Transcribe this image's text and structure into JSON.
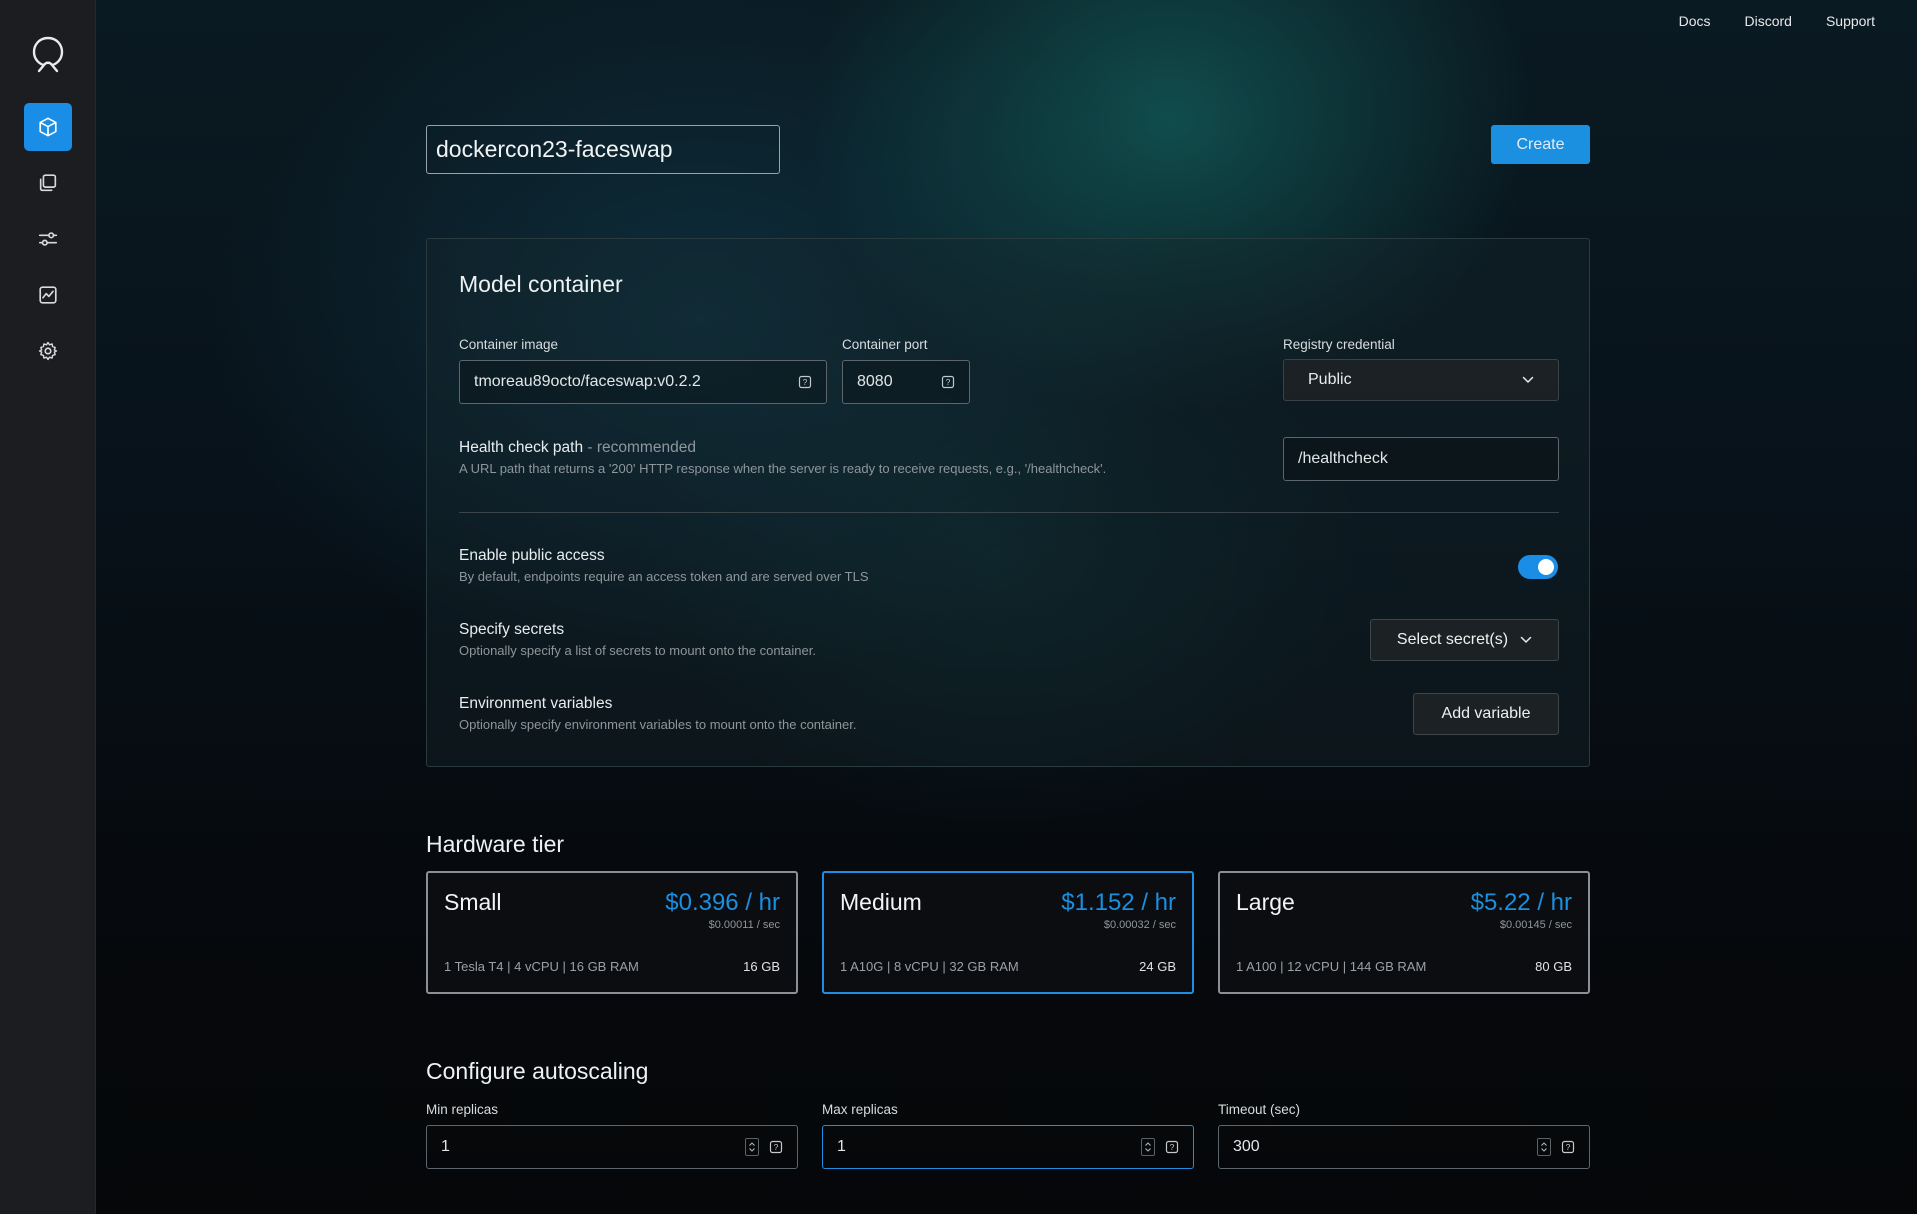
{
  "top_nav": {
    "docs": "Docs",
    "discord": "Discord",
    "support": "Support"
  },
  "sidebar": {
    "icons": [
      "logo-icon",
      "cube-icon",
      "copy-icon",
      "sliders-icon",
      "chart-icon",
      "gear-icon"
    ],
    "active": "cube-icon",
    "accent": "#1a8ee6"
  },
  "header": {
    "name_value": "dockercon23-faceswap",
    "create_label": "Create"
  },
  "model_container": {
    "title": "Model container",
    "container_image_label": "Container image",
    "container_image_value": "tmoreau89octo/faceswap:v0.2.2",
    "container_port_label": "Container port",
    "container_port_value": "8080",
    "registry_label": "Registry credential",
    "registry_value": "Public",
    "health_title": "Health check path",
    "health_suffix": "- recommended",
    "health_desc": "A URL path that returns a '200' HTTP response when the server is ready to receive requests, e.g., '/healthcheck'.",
    "health_value": "/healthcheck",
    "public_title": "Enable public access",
    "public_desc": "By default, endpoints require an access token and are served over TLS",
    "public_enabled": true,
    "secrets_title": "Specify secrets",
    "secrets_desc": "Optionally specify a list of secrets to mount onto the container.",
    "secrets_button": "Select secret(s)",
    "env_title": "Environment variables",
    "env_desc": "Optionally specify environment variables to mount onto the container.",
    "env_button": "Add variable"
  },
  "hardware": {
    "title": "Hardware tier",
    "selected": "Medium",
    "tiers": [
      {
        "name": "Small",
        "price": "$0.396 / hr",
        "per_sec": "$0.00011 / sec",
        "spec": "1 Tesla T4 | 4 vCPU | 16 GB RAM",
        "memory": "16 GB"
      },
      {
        "name": "Medium",
        "price": "$1.152 / hr",
        "per_sec": "$0.00032 / sec",
        "spec": "1 A10G | 8 vCPU | 32 GB RAM",
        "memory": "24 GB"
      },
      {
        "name": "Large",
        "price": "$5.22 / hr",
        "per_sec": "$0.00145 / sec",
        "spec": "1 A100 | 12 vCPU | 144 GB RAM",
        "memory": "80 GB"
      }
    ]
  },
  "autoscaling": {
    "title": "Configure autoscaling",
    "min_label": "Min replicas",
    "min_value": "1",
    "max_label": "Max replicas",
    "max_value": "1",
    "timeout_label": "Timeout (sec)",
    "timeout_value": "300"
  }
}
